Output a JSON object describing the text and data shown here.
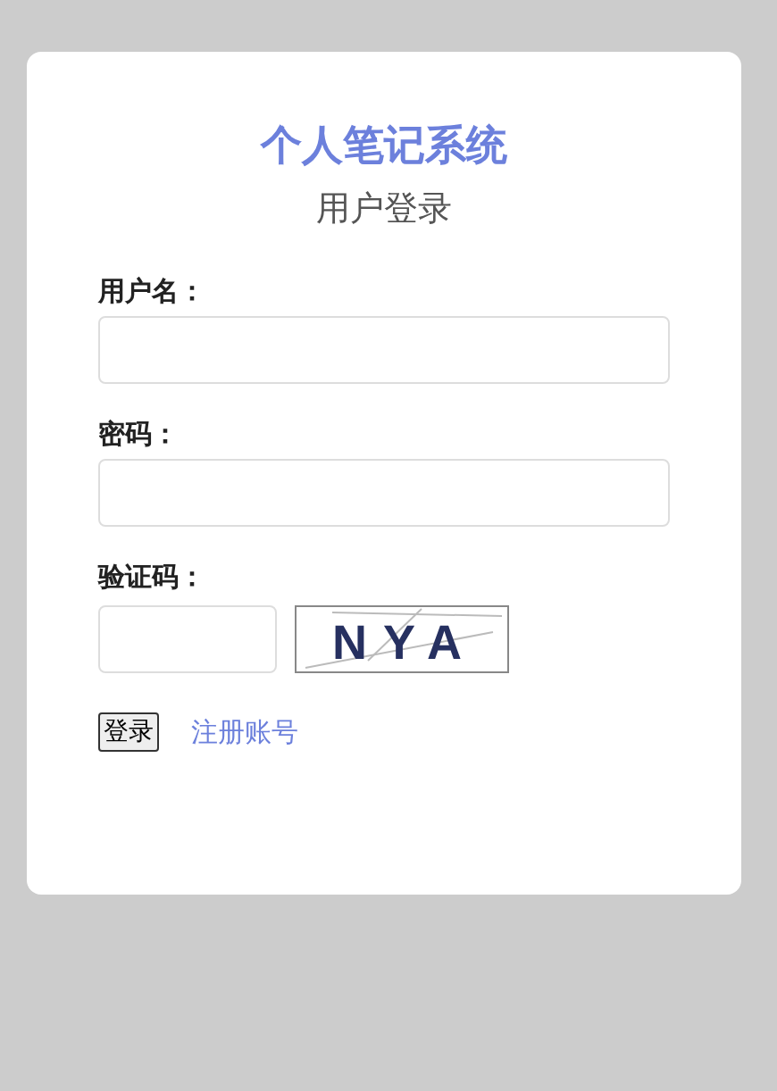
{
  "title": "个人笔记系统",
  "subtitle": "用户登录",
  "fields": [
    {
      "label": "用户名："
    },
    {
      "label": "密码："
    }
  ],
  "captcha": {
    "label": "验证码：",
    "code": "NYA"
  },
  "login_button": "登录",
  "register_link": "注册账号"
}
